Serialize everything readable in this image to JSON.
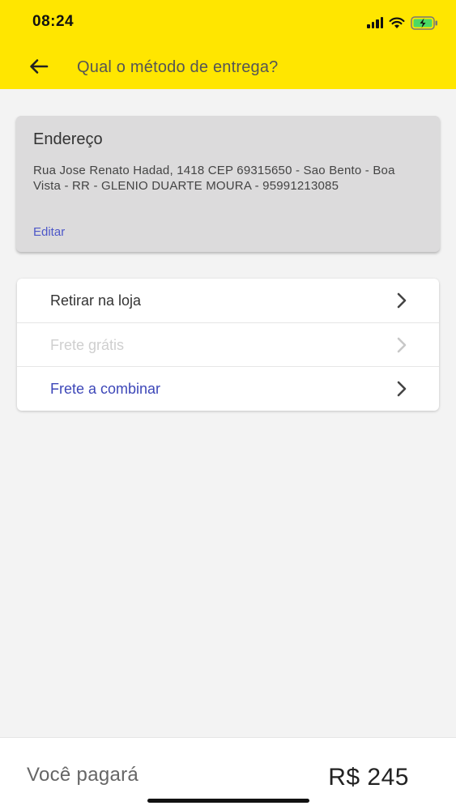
{
  "status_bar": {
    "time": "08:24",
    "icons": [
      "signal-icon",
      "wifi-icon",
      "battery-charging-icon"
    ]
  },
  "header": {
    "title": "Qual o método de entrega?",
    "back_icon": "arrow-left-icon",
    "background_color": "#ffe600"
  },
  "address_card": {
    "title": "Endereço",
    "text": "Rua Jose Renato Hadad, 1418 CEP 69315650 - Sao Bento - Boa Vista - RR - GLENIO DUARTE MOURA - 95991213085",
    "edit_label": "Editar",
    "edit_color": "#4d57c8"
  },
  "delivery_options": [
    {
      "label": "Retirar na loja",
      "color": "#333333",
      "enabled": true
    },
    {
      "label": "Frete grátis",
      "color": "#cfcfcf",
      "enabled": false
    },
    {
      "label": "Frete a combinar",
      "color": "#3d47b8",
      "enabled": true
    }
  ],
  "footer": {
    "label": "Você pagará",
    "total": "R$ 245"
  }
}
